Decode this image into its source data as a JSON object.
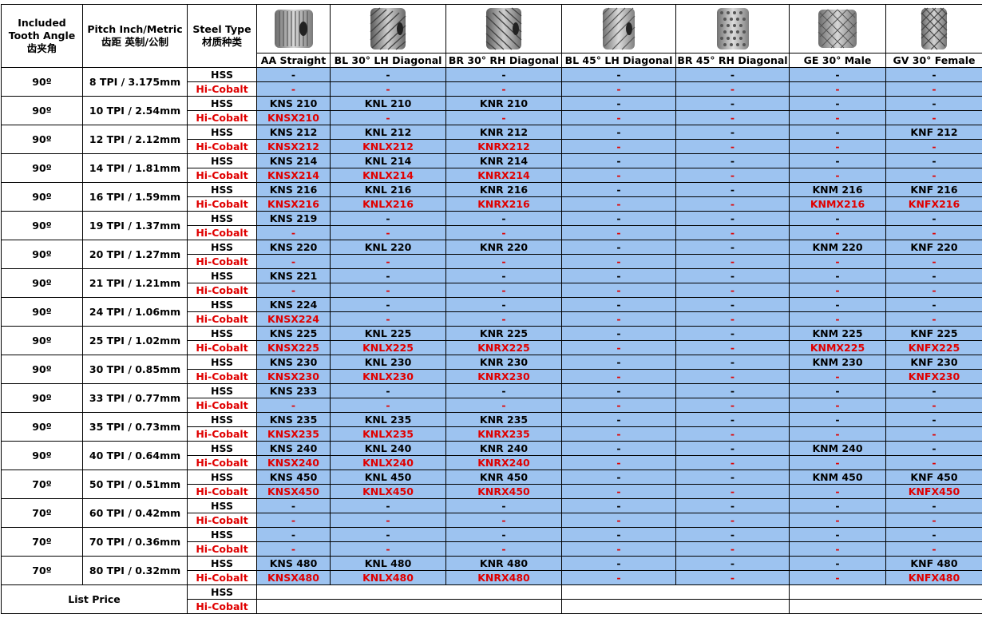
{
  "header": {
    "angle_label_1": "Included",
    "angle_label_2": "Tooth Angle",
    "angle_label_cn": "齿夹角",
    "pitch_label": "Pitch  Inch/Metric",
    "pitch_label_cn": "齿距  英制/公制",
    "steel_label": "Steel Type",
    "steel_label_cn": "材质种类",
    "columns": [
      {
        "label": "AA Straight",
        "icon": "straight-knurl-wheel-icon"
      },
      {
        "label": "BL 30° LH Diagonal",
        "icon": "lh-30-knurl-wheel-icon"
      },
      {
        "label": "BR 30° RH Diagonal",
        "icon": "rh-30-knurl-wheel-icon"
      },
      {
        "label": "BL 45° LH Diagonal",
        "icon": "lh-45-knurl-wheel-icon"
      },
      {
        "label": "BR 45° RH Diagonal",
        "icon": "rh-45-knurl-wheel-icon"
      },
      {
        "label": "GE 30° Male",
        "icon": "male-knurl-wheel-icon"
      },
      {
        "label": "GV 30° Female",
        "icon": "female-knurl-wheel-icon"
      }
    ]
  },
  "rows": [
    {
      "angle": "90º",
      "pitch": "8 TPI / 3.175mm",
      "hss_label": "HSS",
      "hc_label": "Hi-Cobalt",
      "hss": [
        "-",
        "-",
        "-",
        "-",
        "-",
        "-",
        "-"
      ],
      "hc": [
        "-",
        "-",
        "-",
        "-",
        "-",
        "-",
        "-"
      ]
    },
    {
      "angle": "90º",
      "pitch": "10 TPI / 2.54mm",
      "hss_label": "HSS",
      "hc_label": "Hi-Cobalt",
      "hss": [
        "KNS 210",
        "KNL 210",
        "KNR 210",
        "-",
        "-",
        "-",
        "-"
      ],
      "hc": [
        "KNSX210",
        "-",
        "-",
        "-",
        "-",
        "-",
        "-"
      ]
    },
    {
      "angle": "90º",
      "pitch": "12 TPI / 2.12mm",
      "hss_label": "HSS",
      "hc_label": "Hi-Cobalt",
      "hss": [
        "KNS 212",
        "KNL 212",
        "KNR 212",
        "-",
        "-",
        "-",
        "KNF 212"
      ],
      "hc": [
        "KNSX212",
        "KNLX212",
        "KNRX212",
        "-",
        "-",
        "-",
        "-"
      ]
    },
    {
      "angle": "90º",
      "pitch": "14 TPI / 1.81mm",
      "hss_label": "HSS",
      "hc_label": "Hi-Cobalt",
      "hss": [
        "KNS 214",
        "KNL 214",
        "KNR 214",
        "-",
        "-",
        "-",
        "-"
      ],
      "hc": [
        "KNSX214",
        "KNLX214",
        "KNRX214",
        "-",
        "-",
        "-",
        "-"
      ]
    },
    {
      "angle": "90º",
      "pitch": "16 TPI / 1.59mm",
      "hss_label": "HSS",
      "hc_label": "Hi-Cobalt",
      "hss": [
        "KNS 216",
        "KNL 216",
        "KNR 216",
        "-",
        "-",
        "KNM 216",
        "KNF 216"
      ],
      "hc": [
        "KNSX216",
        "KNLX216",
        "KNRX216",
        "-",
        "-",
        "KNMX216",
        "KNFX216"
      ]
    },
    {
      "angle": "90º",
      "pitch": "19 TPI / 1.37mm",
      "hss_label": "HSS",
      "hc_label": "Hi-Cobalt",
      "hss": [
        "KNS 219",
        "-",
        "-",
        "-",
        "-",
        "-",
        "-"
      ],
      "hc": [
        "-",
        "-",
        "-",
        "-",
        "-",
        "-",
        "-"
      ]
    },
    {
      "angle": "90º",
      "pitch": "20 TPI / 1.27mm",
      "hss_label": "HSS",
      "hc_label": "Hi-Cobalt",
      "hss": [
        "KNS 220",
        "KNL 220",
        "KNR 220",
        "-",
        "-",
        "KNM 220",
        "KNF 220"
      ],
      "hc": [
        "-",
        "-",
        "-",
        "-",
        "-",
        "-",
        "-"
      ]
    },
    {
      "angle": "90º",
      "pitch": "21 TPI / 1.21mm",
      "hss_label": "HSS",
      "hc_label": "Hi-Cobalt",
      "hss": [
        "KNS 221",
        "-",
        "-",
        "-",
        "-",
        "-",
        "-"
      ],
      "hc": [
        "-",
        "-",
        "-",
        "-",
        "-",
        "-",
        "-"
      ]
    },
    {
      "angle": "90º",
      "pitch": "24 TPI / 1.06mm",
      "hss_label": "HSS",
      "hc_label": "Hi-Cobalt",
      "hss": [
        "KNS 224",
        "-",
        "-",
        "-",
        "-",
        "-",
        "-"
      ],
      "hc": [
        "KNSX224",
        "-",
        "-",
        "-",
        "-",
        "-",
        "-"
      ]
    },
    {
      "angle": "90º",
      "pitch": "25 TPI / 1.02mm",
      "hss_label": "HSS",
      "hc_label": "Hi-Cobalt",
      "hss": [
        "KNS 225",
        "KNL 225",
        "KNR 225",
        "-",
        "-",
        "KNM 225",
        "KNF 225"
      ],
      "hc": [
        "KNSX225",
        "KNLX225",
        "KNRX225",
        "-",
        "-",
        "KNMX225",
        "KNFX225"
      ]
    },
    {
      "angle": "90º",
      "pitch": "30 TPI / 0.85mm",
      "hss_label": "HSS",
      "hc_label": "Hi-Cobalt",
      "hss": [
        "KNS 230",
        "KNL 230",
        "KNR 230",
        "-",
        "-",
        "KNM 230",
        "KNF 230"
      ],
      "hc": [
        "KNSX230",
        "KNLX230",
        "KNRX230",
        "-",
        "-",
        "-",
        "KNFX230"
      ]
    },
    {
      "angle": "90º",
      "pitch": "33 TPI / 0.77mm",
      "hss_label": "HSS",
      "hc_label": "Hi-Cobalt",
      "hss": [
        "KNS 233",
        "-",
        "-",
        "-",
        "-",
        "-",
        "-"
      ],
      "hc": [
        "-",
        "-",
        "-",
        "-",
        "-",
        "-",
        "-"
      ]
    },
    {
      "angle": "90º",
      "pitch": "35 TPI / 0.73mm",
      "hss_label": "HSS",
      "hc_label": "Hi-Cobalt",
      "hss": [
        "KNS 235",
        "KNL 235",
        "KNR 235",
        "-",
        "-",
        "-",
        "-"
      ],
      "hc": [
        "KNSX235",
        "KNLX235",
        "KNRX235",
        "-",
        "-",
        "-",
        "-"
      ]
    },
    {
      "angle": "90º",
      "pitch": "40 TPI / 0.64mm",
      "hss_label": "HSS",
      "hc_label": "Hi-Cobalt",
      "hss": [
        "KNS 240",
        "KNL 240",
        "KNR 240",
        "-",
        "-",
        "KNM 240",
        "-"
      ],
      "hc": [
        "KNSX240",
        "KNLX240",
        "KNRX240",
        "-",
        "-",
        "-",
        "-"
      ]
    },
    {
      "angle": "70º",
      "pitch": "50 TPI / 0.51mm",
      "hss_label": "HSS",
      "hc_label": "Hi-Cobalt",
      "hss": [
        "KNS 450",
        "KNL 450",
        "KNR 450",
        "-",
        "-",
        "KNM 450",
        "KNF 450"
      ],
      "hc": [
        "KNSX450",
        "KNLX450",
        "KNRX450",
        "-",
        "-",
        "-",
        "KNFX450"
      ]
    },
    {
      "angle": "70º",
      "pitch": "60 TPI / 0.42mm",
      "hss_label": "HSS",
      "hc_label": "Hi-Cobalt",
      "hss": [
        "-",
        "-",
        "-",
        "-",
        "-",
        "-",
        "-"
      ],
      "hc": [
        "-",
        "-",
        "-",
        "-",
        "-",
        "-",
        "-"
      ]
    },
    {
      "angle": "70º",
      "pitch": "70 TPI / 0.36mm",
      "hss_label": "HSS",
      "hc_label": "Hi-Cobalt",
      "hss": [
        "-",
        "-",
        "-",
        "-",
        "-",
        "-",
        "-"
      ],
      "hc": [
        "-",
        "-",
        "-",
        "-",
        "-",
        "-",
        "-"
      ]
    },
    {
      "angle": "70º",
      "pitch": "80 TPI / 0.32mm",
      "hss_label": "HSS",
      "hc_label": "Hi-Cobalt",
      "hss": [
        "KNS 480",
        "KNL 480",
        "KNR 480",
        "-",
        "-",
        "-",
        "KNF 480"
      ],
      "hc": [
        "KNSX480",
        "KNLX480",
        "KNRX480",
        "-",
        "-",
        "-",
        "KNFX480"
      ]
    }
  ],
  "list_price": {
    "label": "List Price",
    "hss_label": "HSS",
    "hc_label": "Hi-Cobalt"
  },
  "colors": {
    "value_cell_bg": "#9dc3f0",
    "hi_cobalt_text": "#e00000"
  }
}
